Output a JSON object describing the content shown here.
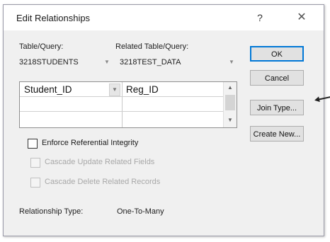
{
  "dialog": {
    "title": "Edit Relationships",
    "help_glyph": "?",
    "close_glyph": "✕"
  },
  "tables": {
    "table_label": "Table/Query:",
    "related_label": "Related Table/Query:",
    "table_value": "3218STUDENTS",
    "related_value": "3218TEST_DATA"
  },
  "grid": {
    "rows": [
      {
        "left": "Student_ID",
        "right": "Reg_ID"
      },
      {
        "left": "",
        "right": ""
      },
      {
        "left": "",
        "right": ""
      }
    ]
  },
  "options": {
    "enforce_label": "Enforce Referential Integrity",
    "enforce_checked": false,
    "cascade_update_label": "Cascade Update Related Fields",
    "cascade_delete_label": "Cascade Delete Related Records"
  },
  "relationship": {
    "type_label": "Relationship Type:",
    "type_value": "One-To-Many"
  },
  "buttons": {
    "ok": "OK",
    "cancel": "Cancel",
    "join_type": "Join Type...",
    "create_new": "Create New..."
  },
  "icons": {
    "dropdown": "▼",
    "scroll_up": "▲",
    "scroll_down": "▼"
  }
}
